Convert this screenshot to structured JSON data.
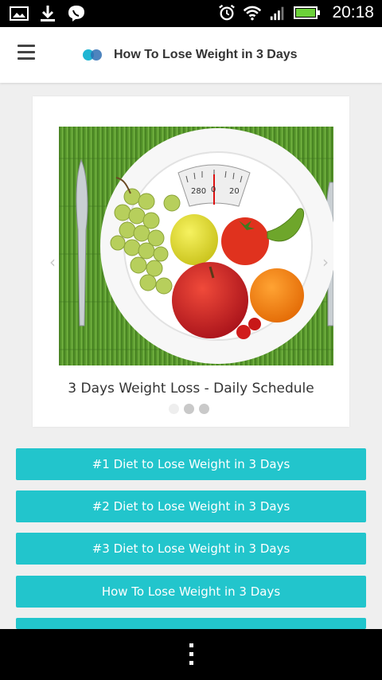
{
  "status_bar": {
    "time": "20:18",
    "icons_left": [
      "gallery-icon",
      "download-icon",
      "viber-icon"
    ],
    "icons_right": [
      "alarm-icon",
      "wifi-icon",
      "signal-icon",
      "battery-icon"
    ]
  },
  "app_bar": {
    "title": "How To Lose Weight in 3 Days",
    "menu_icon": "hamburger-menu-icon",
    "logo_colors": [
      "#1fb5d3",
      "#2f6fb3"
    ]
  },
  "carousel": {
    "image_subject": "plate with fruit and scale on green bamboo mat",
    "scale_labels": [
      "280",
      "0",
      "20"
    ],
    "caption": "3 Days Weight Loss - Daily Schedule",
    "prev_glyph": "‹",
    "next_glyph": "›",
    "slide_count": 3,
    "active_slide": 1
  },
  "buttons": [
    {
      "label": "#1 Diet to Lose Weight in 3 Days"
    },
    {
      "label": "#2 Diet to Lose Weight in 3 Days"
    },
    {
      "label": "#3 Diet to Lose Weight in 3 Days"
    },
    {
      "label": "How To Lose Weight in 3 Days"
    },
    {
      "label": ""
    }
  ],
  "colors": {
    "button_bg": "#22c5cc",
    "page_bg": "#efefef"
  },
  "nav_bar": {
    "icon": "overflow-menu-icon"
  }
}
